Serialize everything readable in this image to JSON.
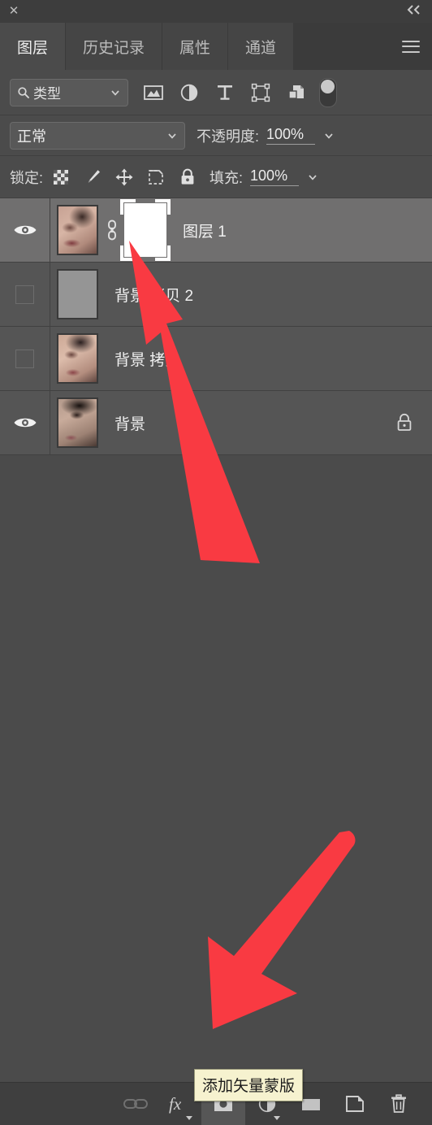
{
  "window": {
    "close_label": "✕",
    "collapse_label": "«"
  },
  "tabs": [
    {
      "label": "图层",
      "active": true
    },
    {
      "label": "历史记录",
      "active": false
    },
    {
      "label": "属性",
      "active": false
    },
    {
      "label": "通道",
      "active": false
    }
  ],
  "panel_menu": {
    "name": "panel-menu-icon"
  },
  "filter": {
    "search_icon": "search-icon",
    "type_label": "类型",
    "chevron": "chevron-down-icon",
    "icons": [
      {
        "name": "filter-pixel-layers-icon"
      },
      {
        "name": "filter-adjustment-layers-icon"
      },
      {
        "name": "filter-type-layers-icon"
      },
      {
        "name": "filter-shape-layers-icon"
      },
      {
        "name": "filter-smart-object-layers-icon"
      }
    ],
    "toggle": {
      "name": "filter-enable-toggle",
      "on": false
    }
  },
  "blend": {
    "mode_label": "正常",
    "opacity_label": "不透明度:",
    "opacity_value": "100%",
    "chevron": "chevron-down-icon"
  },
  "lock": {
    "label": "锁定:",
    "icons": [
      {
        "name": "lock-transparent-pixels-icon"
      },
      {
        "name": "lock-image-pixels-icon"
      },
      {
        "name": "lock-position-icon"
      },
      {
        "name": "lock-artboard-nesting-icon"
      },
      {
        "name": "lock-all-icon"
      }
    ],
    "fill_label": "填充:",
    "fill_value": "100%"
  },
  "layers": [
    {
      "name": "图层 1",
      "visible": true,
      "selected": true,
      "thumb": "portrait-a",
      "has_link": true,
      "has_mask": true,
      "mask_selected": true,
      "locked": false
    },
    {
      "name": "背景 拷贝 2",
      "visible": false,
      "selected": false,
      "thumb": "flat-gray",
      "has_link": false,
      "has_mask": false,
      "mask_selected": false,
      "locked": false
    },
    {
      "name": "背景 拷贝",
      "visible": false,
      "selected": false,
      "thumb": "portrait-b",
      "has_link": false,
      "has_mask": false,
      "mask_selected": false,
      "locked": false
    },
    {
      "name": "背景",
      "visible": true,
      "selected": false,
      "thumb": "portrait-c",
      "has_link": false,
      "has_mask": false,
      "mask_selected": false,
      "locked": true
    }
  ],
  "bottom_toolbar": [
    {
      "name": "link-layers-button",
      "disabled": true
    },
    {
      "name": "layer-style-fx-button",
      "disabled": false,
      "caret": true
    },
    {
      "name": "add-layer-mask-button",
      "disabled": false,
      "hover": true
    },
    {
      "name": "new-adjustment-layer-button",
      "disabled": false,
      "caret": true
    },
    {
      "name": "new-group-button",
      "disabled": false
    },
    {
      "name": "new-layer-button",
      "disabled": false
    },
    {
      "name": "delete-layer-button",
      "disabled": false
    }
  ],
  "tooltip": {
    "text": "添加矢量蒙版"
  },
  "annotations": {
    "arrow_color": "#f93a42",
    "arrow_upper": "points up-left toward the layer mask thumbnail of 图层 1",
    "arrow_lower": "points down-left toward the add layer mask button"
  },
  "colors": {
    "panel_bg": "#4b4b4b",
    "titlebar_bg": "#3d3d3d",
    "tab_inactive_bg": "#454545",
    "tab_active_bg": "#4b4b4b",
    "row_bg": "#555555",
    "row_selected_bg": "#706f6f",
    "bottombar_bg": "#3f3f3f",
    "tooltip_bg": "#f6f2cf",
    "accent_red": "#f93a42"
  }
}
